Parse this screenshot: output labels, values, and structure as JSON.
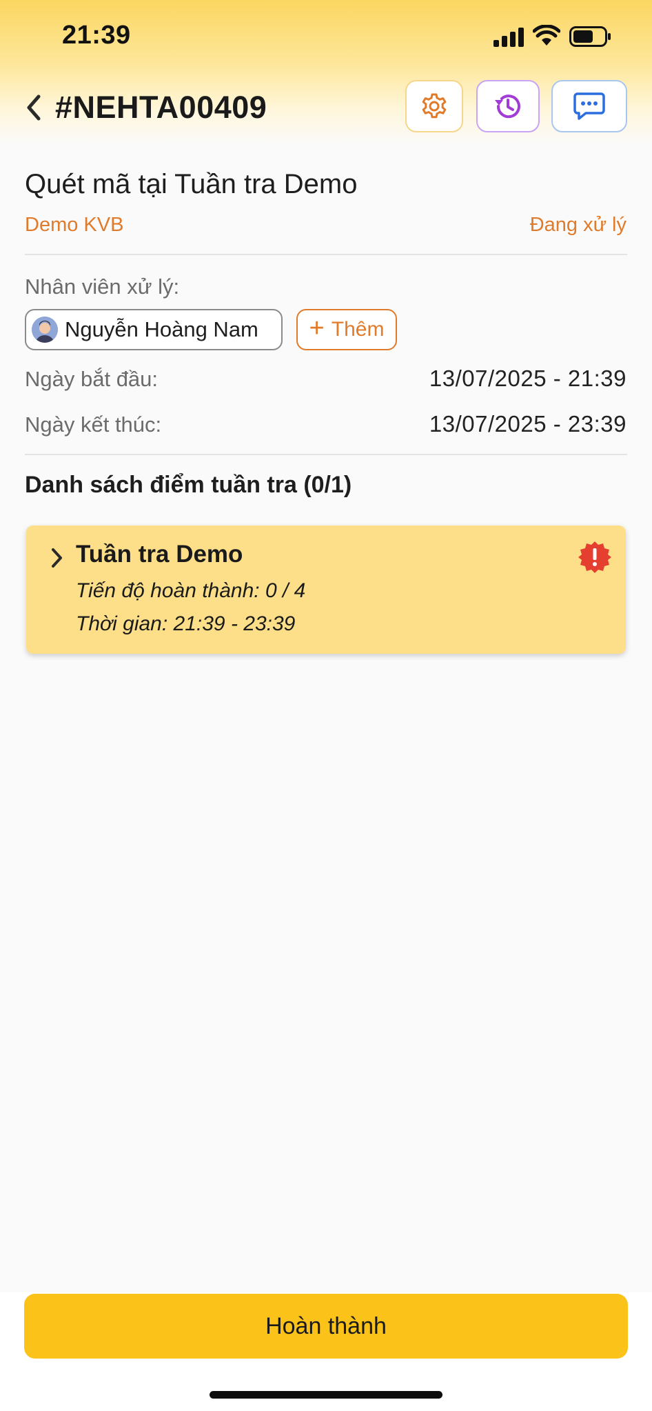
{
  "status_bar": {
    "time": "21:39"
  },
  "header": {
    "ticket_id": "#NEHTA00409"
  },
  "task": {
    "title": "Quét mã tại Tuần tra Demo",
    "area": "Demo KVB",
    "status": "Đang xử lý",
    "status_color": "#e07b2b"
  },
  "assignees": {
    "label": "Nhân viên xử lý:",
    "people": [
      {
        "name": "Nguyễn Hoàng Nam"
      }
    ],
    "add_label": "Thêm"
  },
  "dates": {
    "start_label": "Ngày bắt đầu:",
    "start_value": "13/07/2025 - 21:39",
    "end_label": "Ngày kết thúc:",
    "end_value": "13/07/2025 - 23:39"
  },
  "checkpoints": {
    "title": "Danh sách điểm tuần tra (0/1)",
    "items": [
      {
        "name": "Tuần tra Demo",
        "progress": "Tiến độ hoàn thành: 0 / 4",
        "time": "Thời gian: 21:39 - 23:39",
        "card_color": "#fddf89",
        "alert_color": "#e5402f"
      }
    ]
  },
  "footer": {
    "complete_label": "Hoàn thành",
    "button_color": "#fbc21a"
  }
}
